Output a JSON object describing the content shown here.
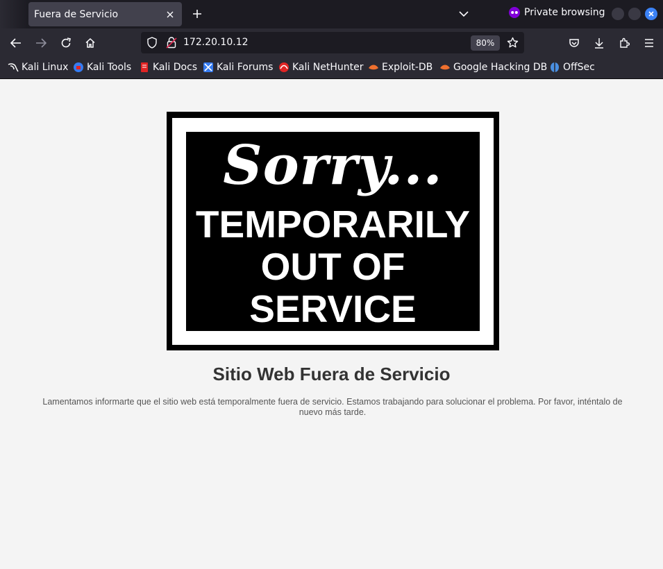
{
  "browser": {
    "tab": {
      "title": "Fuera de Servicio",
      "close_icon": "close-icon"
    },
    "new_tab_icon": "plus-icon",
    "private_label": "Private browsing",
    "url": "172.20.10.12",
    "zoom": "80%",
    "bookmarks": [
      {
        "label": "Kali Linux",
        "icon": "kali-dragon-icon",
        "color": "#ffffff"
      },
      {
        "label": "Kali Tools",
        "icon": "kali-tools-icon",
        "color": "#367bf0"
      },
      {
        "label": "Kali Docs",
        "icon": "kali-docs-icon",
        "color": "#e02424"
      },
      {
        "label": "Kali Forums",
        "icon": "kali-forums-icon",
        "color": "#367bf0"
      },
      {
        "label": "Kali NetHunter",
        "icon": "nethunter-icon",
        "color": "#e02424"
      },
      {
        "label": "Exploit-DB",
        "icon": "exploit-db-icon",
        "color": "#f0702e"
      },
      {
        "label": "Google Hacking DB",
        "icon": "ghdb-icon",
        "color": "#f0702e"
      },
      {
        "label": "OffSec",
        "icon": "offsec-icon",
        "color": "#4a90e2"
      }
    ]
  },
  "page": {
    "sign": {
      "line1": "Sorry...",
      "line2": "TEMPORARILY",
      "line3": "OUT OF",
      "line4": "SERVICE"
    },
    "heading": "Sitio Web Fuera de Servicio",
    "message": "Lamentamos informarte que el sitio web está temporalmente fuera de servicio. Estamos trabajando para solucionar el problema. Por favor, inténtalo de nuevo más tarde."
  },
  "colors": {
    "chrome_dark": "#1c1b22",
    "chrome": "#2b2a33",
    "tab_active": "#42414d",
    "private_purple": "#8000d7",
    "close_blue": "#3b82f6"
  }
}
